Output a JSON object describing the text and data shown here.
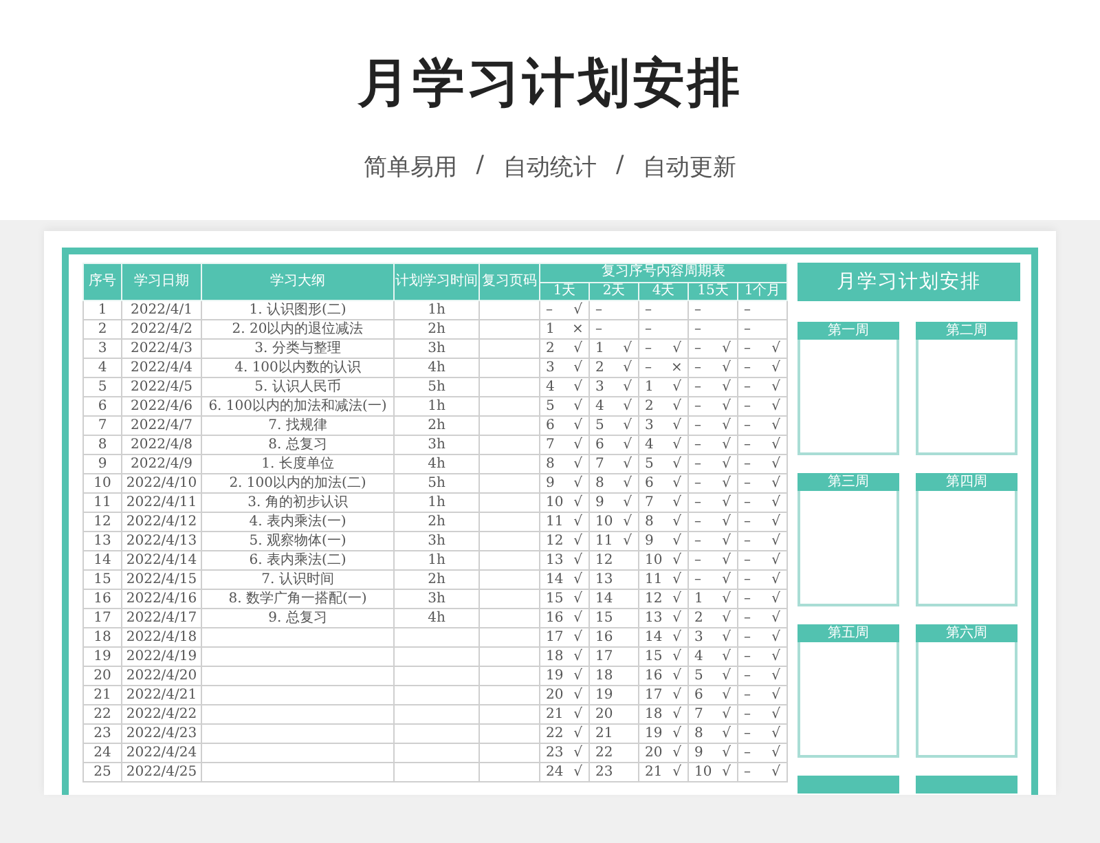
{
  "title": "月学习计划安排",
  "subtitle": [
    "简单易用",
    "/",
    "自动统计",
    "/",
    "自动更新"
  ],
  "table": {
    "columns": [
      "序号",
      "学习日期",
      "学习大纲",
      "计划学习时间",
      "复习页码"
    ],
    "review_title": "复习序号内容周期表",
    "periods": [
      "1天",
      "2天",
      "4天",
      "15天",
      "1个月"
    ],
    "rows": [
      {
        "no": "1",
        "date": "2022/4/1",
        "outline": "1. 认识图形(二)",
        "hours": "1h",
        "review": [
          [
            "–",
            "√"
          ],
          [
            "–"
          ],
          [
            "–"
          ],
          [
            "–"
          ],
          [
            "–"
          ]
        ]
      },
      {
        "no": "2",
        "date": "2022/4/2",
        "outline": "2. 20以内的退位减法",
        "hours": "2h",
        "review": [
          [
            "1",
            "×"
          ],
          [
            "–"
          ],
          [
            "–"
          ],
          [
            "–"
          ],
          [
            "–"
          ]
        ]
      },
      {
        "no": "3",
        "date": "2022/4/3",
        "outline": "3. 分类与整理",
        "hours": "3h",
        "review": [
          [
            "2",
            "√"
          ],
          [
            "1",
            "√"
          ],
          [
            "–",
            "√"
          ],
          [
            "–",
            "√"
          ],
          [
            "–",
            "√"
          ]
        ]
      },
      {
        "no": "4",
        "date": "2022/4/4",
        "outline": "4. 100以内数的认识",
        "hours": "4h",
        "review": [
          [
            "3",
            "√"
          ],
          [
            "2",
            "√"
          ],
          [
            "–",
            "×"
          ],
          [
            "–",
            "√"
          ],
          [
            "–",
            "√"
          ]
        ]
      },
      {
        "no": "5",
        "date": "2022/4/5",
        "outline": "5. 认识人民币",
        "hours": "5h",
        "review": [
          [
            "4",
            "√"
          ],
          [
            "3",
            "√"
          ],
          [
            "1",
            "√"
          ],
          [
            "–",
            "√"
          ],
          [
            "–",
            "√"
          ]
        ]
      },
      {
        "no": "6",
        "date": "2022/4/6",
        "outline": "6. 100以内的加法和减法(一)",
        "hours": "1h",
        "review": [
          [
            "5",
            "√"
          ],
          [
            "4",
            "√"
          ],
          [
            "2",
            "√"
          ],
          [
            "–",
            "√"
          ],
          [
            "–",
            "√"
          ]
        ]
      },
      {
        "no": "7",
        "date": "2022/4/7",
        "outline": "7. 找规律",
        "hours": "2h",
        "review": [
          [
            "6",
            "√"
          ],
          [
            "5",
            "√"
          ],
          [
            "3",
            "√"
          ],
          [
            "–",
            "√"
          ],
          [
            "–",
            "√"
          ]
        ]
      },
      {
        "no": "8",
        "date": "2022/4/8",
        "outline": "8. 总复习",
        "hours": "3h",
        "review": [
          [
            "7",
            "√"
          ],
          [
            "6",
            "√"
          ],
          [
            "4",
            "√"
          ],
          [
            "–",
            "√"
          ],
          [
            "–",
            "√"
          ]
        ]
      },
      {
        "no": "9",
        "date": "2022/4/9",
        "outline": "1. 长度单位",
        "hours": "4h",
        "review": [
          [
            "8",
            "√"
          ],
          [
            "7",
            "√"
          ],
          [
            "5",
            "√"
          ],
          [
            "–",
            "√"
          ],
          [
            "–",
            "√"
          ]
        ]
      },
      {
        "no": "10",
        "date": "2022/4/10",
        "outline": "2. 100以内的加法(二)",
        "hours": "5h",
        "review": [
          [
            "9",
            "√"
          ],
          [
            "8",
            "√"
          ],
          [
            "6",
            "√"
          ],
          [
            "–",
            "√"
          ],
          [
            "–",
            "√"
          ]
        ]
      },
      {
        "no": "11",
        "date": "2022/4/11",
        "outline": "3. 角的初步认识",
        "hours": "1h",
        "review": [
          [
            "10",
            "√"
          ],
          [
            "9",
            "√"
          ],
          [
            "7",
            "√"
          ],
          [
            "–",
            "√"
          ],
          [
            "–",
            "√"
          ]
        ]
      },
      {
        "no": "12",
        "date": "2022/4/12",
        "outline": "4. 表内乘法(一)",
        "hours": "2h",
        "review": [
          [
            "11",
            "√"
          ],
          [
            "10",
            "√"
          ],
          [
            "8",
            "√"
          ],
          [
            "–",
            "√"
          ],
          [
            "–",
            "√"
          ]
        ]
      },
      {
        "no": "13",
        "date": "2022/4/13",
        "outline": "5. 观察物体(一)",
        "hours": "3h",
        "review": [
          [
            "12",
            "√"
          ],
          [
            "11",
            "√"
          ],
          [
            "9",
            "√"
          ],
          [
            "–",
            "√"
          ],
          [
            "–",
            "√"
          ]
        ]
      },
      {
        "no": "14",
        "date": "2022/4/14",
        "outline": "6. 表内乘法(二)",
        "hours": "1h",
        "review": [
          [
            "13",
            "√"
          ],
          [
            "12"
          ],
          [
            "10",
            "√"
          ],
          [
            "–",
            "√"
          ],
          [
            "–",
            "√"
          ]
        ]
      },
      {
        "no": "15",
        "date": "2022/4/15",
        "outline": "7. 认识时间",
        "hours": "2h",
        "review": [
          [
            "14",
            "√"
          ],
          [
            "13"
          ],
          [
            "11",
            "√"
          ],
          [
            "–",
            "√"
          ],
          [
            "–",
            "√"
          ]
        ]
      },
      {
        "no": "16",
        "date": "2022/4/16",
        "outline": "8. 数学广角一搭配(一)",
        "hours": "3h",
        "review": [
          [
            "15",
            "√"
          ],
          [
            "14"
          ],
          [
            "12",
            "√"
          ],
          [
            "1",
            "√"
          ],
          [
            "–",
            "√"
          ]
        ]
      },
      {
        "no": "17",
        "date": "2022/4/17",
        "outline": "9. 总复习",
        "hours": "4h",
        "review": [
          [
            "16",
            "√"
          ],
          [
            "15"
          ],
          [
            "13",
            "√"
          ],
          [
            "2",
            "√"
          ],
          [
            "–",
            "√"
          ]
        ]
      },
      {
        "no": "18",
        "date": "2022/4/18",
        "review": [
          [
            "17",
            "√"
          ],
          [
            "16"
          ],
          [
            "14",
            "√"
          ],
          [
            "3",
            "√"
          ],
          [
            "–",
            "√"
          ]
        ]
      },
      {
        "no": "19",
        "date": "2022/4/19",
        "review": [
          [
            "18",
            "√"
          ],
          [
            "17"
          ],
          [
            "15",
            "√"
          ],
          [
            "4",
            "√"
          ],
          [
            "–",
            "√"
          ]
        ]
      },
      {
        "no": "20",
        "date": "2022/4/20",
        "review": [
          [
            "19",
            "√"
          ],
          [
            "18"
          ],
          [
            "16",
            "√"
          ],
          [
            "5",
            "√"
          ],
          [
            "–",
            "√"
          ]
        ]
      },
      {
        "no": "21",
        "date": "2022/4/21",
        "review": [
          [
            "20",
            "√"
          ],
          [
            "19"
          ],
          [
            "17",
            "√"
          ],
          [
            "6",
            "√"
          ],
          [
            "–",
            "√"
          ]
        ]
      },
      {
        "no": "22",
        "date": "2022/4/22",
        "review": [
          [
            "21",
            "√"
          ],
          [
            "20"
          ],
          [
            "18",
            "√"
          ],
          [
            "7",
            "√"
          ],
          [
            "–",
            "√"
          ]
        ]
      },
      {
        "no": "23",
        "date": "2022/4/23",
        "review": [
          [
            "22",
            "√"
          ],
          [
            "21"
          ],
          [
            "19",
            "√"
          ],
          [
            "8",
            "√"
          ],
          [
            "–",
            "√"
          ]
        ]
      },
      {
        "no": "24",
        "date": "2022/4/24",
        "review": [
          [
            "23",
            "√"
          ],
          [
            "22"
          ],
          [
            "20",
            "√"
          ],
          [
            "9",
            "√"
          ],
          [
            "–",
            "√"
          ]
        ]
      },
      {
        "no": "25",
        "date": "2022/4/25",
        "review": [
          [
            "24",
            "√"
          ],
          [
            "23"
          ],
          [
            "21",
            "√"
          ],
          [
            "10",
            "√"
          ],
          [
            "–",
            "√"
          ]
        ]
      }
    ]
  },
  "panel": {
    "title": "月学习计划安排",
    "weeks": [
      "第一周",
      "第二周",
      "第三周",
      "第四周",
      "第五周",
      "第六周"
    ]
  }
}
